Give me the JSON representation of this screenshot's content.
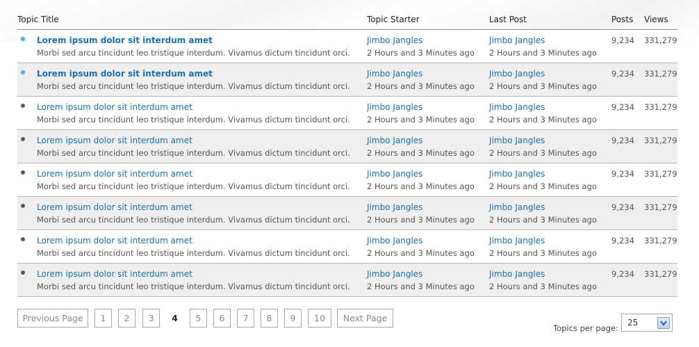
{
  "header": {
    "topic_title": "Topic Title",
    "topic_starter": "Topic Starter",
    "last_post": "Last Post",
    "posts": "Posts",
    "views": "Views"
  },
  "topics": [
    {
      "title": "Lorem ipsum dolor sit interdum amet",
      "description": "Morbi sed arcu tincidunt leo tristique interdum. Vivamus dictum tincidunt orci.",
      "starter": "Jimbo Jangles",
      "starter_time": "2 Hours and 3 Minutes ago",
      "last_post_by": "Jimbo Jangles",
      "last_post_time": "2 Hours and 3 Minutes ago",
      "posts": "9,234",
      "views": "331,279",
      "unread": true
    },
    {
      "title": "Lorem ipsum dolor sit interdum amet",
      "description": "Morbi sed arcu tincidunt leo tristique interdum. Vivamus dictum tincidunt orci.",
      "starter": "Jimbo Jangles",
      "starter_time": "2 Hours and 3 Minutes ago",
      "last_post_by": "Jimbo Jangles",
      "last_post_time": "2 Hours and 3 Minutes ago",
      "posts": "9,234",
      "views": "331,279",
      "unread": true
    },
    {
      "title": "Lorem ipsum dolor sit interdum amet",
      "description": "Morbi sed arcu tincidunt leo tristique interdum. Vivamus dictum tincidunt orci.",
      "starter": "Jimbo Jangles",
      "starter_time": "2 Hours and 3 Minutes ago",
      "last_post_by": "Jimbo Jangles",
      "last_post_time": "2 Hours and 3 Minutes ago",
      "posts": "9,234",
      "views": "331,279",
      "unread": false
    },
    {
      "title": "Lorem ipsum dolor sit interdum amet",
      "description": "Morbi sed arcu tincidunt leo tristique interdum. Vivamus dictum tincidunt orci.",
      "starter": "Jimbo Jangles",
      "starter_time": "2 Hours and 3 Minutes ago",
      "last_post_by": "Jimbo Jangles",
      "last_post_time": "2 Hours and 3 Minutes ago",
      "posts": "9,234",
      "views": "331,279",
      "unread": false
    },
    {
      "title": "Lorem ipsum dolor sit interdum amet",
      "description": "Morbi sed arcu tincidunt leo tristique interdum. Vivamus dictum tincidunt orci.",
      "starter": "Jimbo Jangles",
      "starter_time": "2 Hours and 3 Minutes ago",
      "last_post_by": "Jimbo Jangles",
      "last_post_time": "2 Hours and 3 Minutes ago",
      "posts": "9,234",
      "views": "331,279",
      "unread": false
    },
    {
      "title": "Lorem ipsum dolor sit interdum amet",
      "description": "Morbi sed arcu tincidunt leo tristique interdum. Vivamus dictum tincidunt orci.",
      "starter": "Jimbo Jangles",
      "starter_time": "2 Hours and 3 Minutes ago",
      "last_post_by": "Jimbo Jangles",
      "last_post_time": "2 Hours and 3 Minutes ago",
      "posts": "9,234",
      "views": "331,279",
      "unread": false
    },
    {
      "title": "Lorem ipsum dolor sit interdum amet",
      "description": "Morbi sed arcu tincidunt leo tristique interdum. Vivamus dictum tincidunt orci.",
      "starter": "Jimbo Jangles",
      "starter_time": "2 Hours and 3 Minutes ago",
      "last_post_by": "Jimbo Jangles",
      "last_post_time": "2 Hours and 3 Minutes ago",
      "posts": "9,234",
      "views": "331,279",
      "unread": false
    },
    {
      "title": "Lorem ipsum dolor sit interdum amet",
      "description": "Morbi sed arcu tincidunt leo tristique interdum. Vivamus dictum tincidunt orci.",
      "starter": "Jimbo Jangles",
      "starter_time": "2 Hours and 3 Minutes ago",
      "last_post_by": "Jimbo Jangles",
      "last_post_time": "2 Hours and 3 Minutes ago",
      "posts": "9,234",
      "views": "331,279",
      "unread": false
    }
  ],
  "pagination": {
    "previous_label": "Previous Page",
    "next_label": "Next Page",
    "pages": [
      "1",
      "2",
      "3",
      "4",
      "5",
      "6",
      "7",
      "8",
      "9",
      "10"
    ],
    "current_page": "4"
  },
  "topics_per_page": {
    "label": "Topics per page:",
    "value": "25"
  },
  "colors": {
    "link": "#1b6fb5",
    "unread_bullet": "#5ab0e6",
    "read_bullet": "#5b5b5b",
    "alt_row": "#efefef"
  },
  "icons": {
    "unread": "unread-topic-icon",
    "read": "read-topic-icon",
    "dropdown": "chevron-down-icon"
  }
}
